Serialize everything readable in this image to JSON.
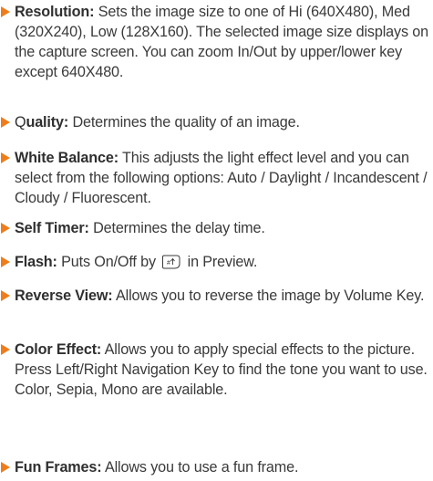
{
  "items": [
    {
      "term": "Resolution:",
      "desc": "Sets the image size to one of Hi (640X480), Med (320X240), Low (128X160). The selected image size displays on the capture screen. You can zoom In/Out by upper/lower key except 640X480."
    },
    {
      "term_first": "Q",
      "term_rest": "uality:",
      "desc": "Determines the quality of an image."
    },
    {
      "term": "White Balance:",
      "desc": "This adjusts the light effect level and you can select from the following options: Auto / Daylight / Incandescent / Cloudy / Fluorescent."
    },
    {
      "term": "Self Timer:",
      "desc": "Determines the delay time."
    },
    {
      "term": "Flash:",
      "desc_before": "Puts On/Off by",
      "key_icon": "hash-key-icon",
      "desc_after": "in Preview."
    },
    {
      "term": "Reverse View:",
      "desc": "Allows you to reverse the image by Volume Key."
    },
    {
      "term": "Color Effect:",
      "desc": "Allows you to apply special effects to the picture. Press Left/Right Navigation Key to find the tone you want to use. Color, Sepia, Mono are available."
    },
    {
      "term": "Fun Frames:",
      "desc": "Allows you to use a fun frame."
    }
  ],
  "colors": {
    "bullet": "#f07d1a",
    "text": "#3a3a3a"
  }
}
